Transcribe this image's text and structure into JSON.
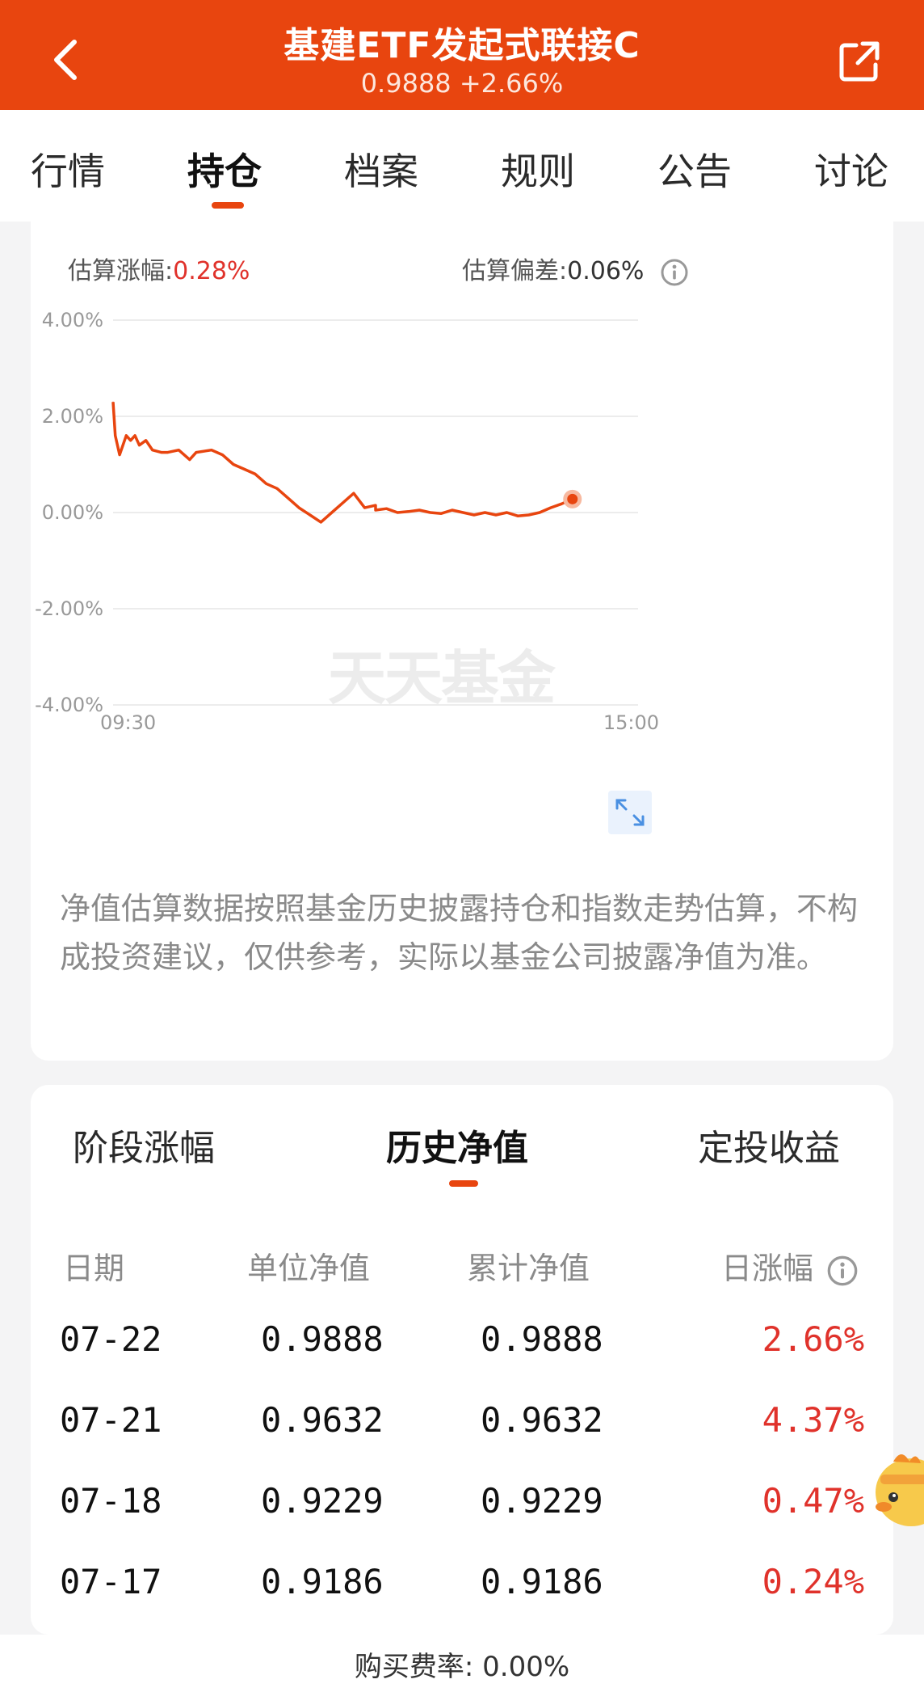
{
  "header": {
    "title": "基建ETF发起式联接C",
    "nav_value": "0.9888",
    "nav_change": "+2.66%"
  },
  "tabs": [
    "行情",
    "持仓",
    "档案",
    "规则",
    "公告",
    "讨论"
  ],
  "active_tab": "持仓",
  "estimate": {
    "change_label": "估算涨幅:",
    "change_value": "0.28%",
    "deviation_label": "估算偏差:",
    "deviation_value": "0.06%"
  },
  "chart_data": {
    "type": "line",
    "y_tick_labels": [
      "4.00%",
      "2.00%",
      "0.00%",
      "-2.00%",
      "-4.00%"
    ],
    "ylim": [
      -4,
      4
    ],
    "x_tick_labels": [
      "09:30",
      "15:00"
    ],
    "watermark": "天天基金",
    "line_color": "#e8450f",
    "x": [
      "09:30",
      "09:31",
      "09:33",
      "09:36",
      "09:38",
      "09:40",
      "09:42",
      "09:45",
      "09:48",
      "09:52",
      "09:55",
      "10:00",
      "10:05",
      "10:08",
      "10:15",
      "10:20",
      "10:25",
      "10:30",
      "10:35",
      "10:40",
      "10:45",
      "10:50",
      "10:55",
      "11:00",
      "11:05",
      "11:10",
      "11:15",
      "11:20",
      "11:25",
      "11:30",
      "13:00",
      "13:05",
      "13:10",
      "13:15",
      "13:20",
      "13:25",
      "13:30",
      "13:35",
      "13:40",
      "13:45",
      "13:50",
      "13:55",
      "14:00",
      "14:05",
      "14:10",
      "14:15",
      "14:20",
      "14:25",
      "14:30"
    ],
    "y": [
      2.3,
      1.6,
      1.2,
      1.6,
      1.5,
      1.6,
      1.4,
      1.5,
      1.3,
      1.25,
      1.25,
      1.3,
      1.1,
      1.25,
      1.3,
      1.2,
      1.0,
      0.9,
      0.8,
      0.6,
      0.5,
      0.3,
      0.1,
      -0.05,
      -0.2,
      0.0,
      0.2,
      0.4,
      0.1,
      0.15,
      0.05,
      0.08,
      0.0,
      0.02,
      0.05,
      0.0,
      -0.02,
      0.05,
      0.0,
      -0.05,
      0.0,
      -0.05,
      0.0,
      -0.07,
      -0.05,
      0.0,
      0.1,
      0.18,
      0.28
    ],
    "grid": true
  },
  "note": "净值估算数据按照基金历史披露持仓和指数走势估算，不构成投资建议，仅供参考，实际以基金公司披露净值为准。",
  "sub_tabs": [
    "阶段涨幅",
    "历史净值",
    "定投收益"
  ],
  "active_sub_tab": "历史净值",
  "table": {
    "headers": [
      "日期",
      "单位净值",
      "累计净值",
      "日涨幅"
    ],
    "rows": [
      {
        "date": "07-22",
        "unit_nav": "0.9888",
        "acc_nav": "0.9888",
        "change": "2.66%"
      },
      {
        "date": "07-21",
        "unit_nav": "0.9632",
        "acc_nav": "0.9632",
        "change": "4.37%"
      },
      {
        "date": "07-18",
        "unit_nav": "0.9229",
        "acc_nav": "0.9229",
        "change": "0.47%"
      },
      {
        "date": "07-17",
        "unit_nav": "0.9186",
        "acc_nav": "0.9186",
        "change": "0.24%"
      }
    ]
  },
  "footer": {
    "fee_label": "购买费率:",
    "fee_value": "0.00%"
  },
  "colors": {
    "brand": "#e8450f",
    "up": "#e0322b"
  }
}
